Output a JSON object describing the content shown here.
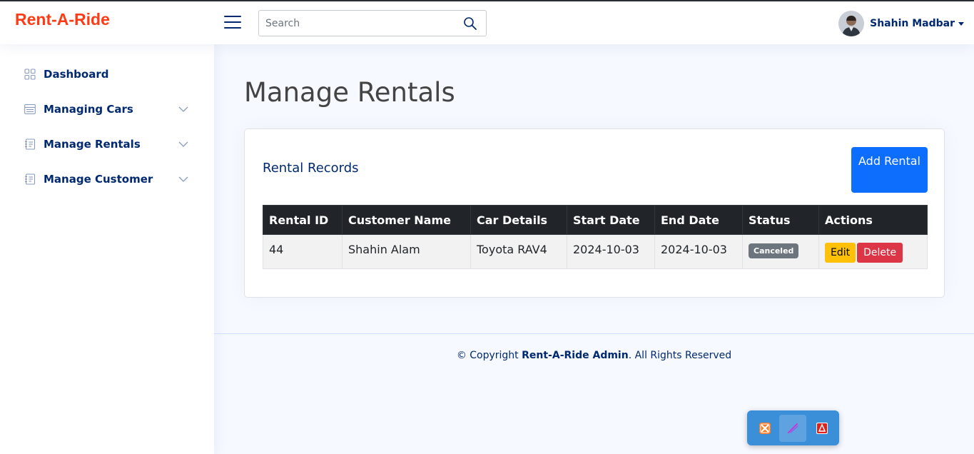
{
  "header": {
    "logo": "Rent-A-Ride",
    "search_placeholder": "Search",
    "user_name": "Shahin Madbar"
  },
  "sidebar": {
    "items": [
      {
        "label": "Dashboard",
        "icon": "grid-icon"
      },
      {
        "label": "Managing Cars",
        "icon": "menu-button-icon"
      },
      {
        "label": "Manage Rentals",
        "icon": "journal-text-icon"
      },
      {
        "label": "Manage Customer",
        "icon": "journal-text-icon"
      }
    ]
  },
  "main": {
    "page_title": "Manage Rentals",
    "card_title": "Rental Records",
    "add_button": "Add Rental",
    "table": {
      "headers": [
        "Rental ID",
        "Customer Name",
        "Car Details",
        "Start Date",
        "End Date",
        "Status",
        "Actions"
      ],
      "rows": [
        {
          "rental_id": "44",
          "customer_name": "Shahin Alam",
          "car_details": "Toyota RAV4",
          "start_date": "2024-10-03",
          "end_date": "2024-10-03",
          "status": "Canceled",
          "edit_label": "Edit",
          "delete_label": "Delete"
        }
      ]
    }
  },
  "footer": {
    "prefix": "© Copyright ",
    "brand": "Rent-A-Ride Admin",
    "suffix": ". All Rights Reserved"
  },
  "taskbar": {
    "apps": [
      "xampp-icon",
      "vscode-pen-icon",
      "acrobat-icon"
    ]
  },
  "colors": {
    "logo": "#ff3b16",
    "primary": "#0d6efd",
    "nav_text": "#012970",
    "table_header": "#212529",
    "badge": "#6c757d",
    "edit": "#ffc107",
    "delete": "#dc3545"
  }
}
